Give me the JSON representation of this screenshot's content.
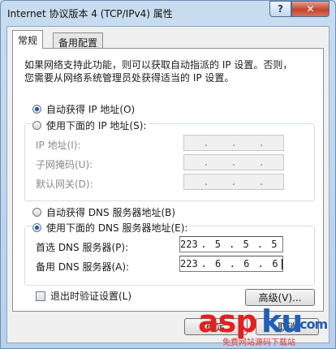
{
  "window": {
    "title": "Internet 协议版本 4 (TCP/IPv4) 属性",
    "help_label": "?",
    "close_label": "✕"
  },
  "tabs": [
    {
      "label": "常规",
      "active": true
    },
    {
      "label": "备用配置",
      "active": false
    }
  ],
  "description": [
    "如果网络支持此功能，则可以获取自动指派的 IP 设置。否则，",
    "您需要从网络系统管理员处获得适当的 IP 设置。"
  ],
  "ip_section": {
    "auto_label": "自动获得 IP 地址(O)",
    "manual_label": "使用下面的 IP 地址(S):",
    "selected": "auto",
    "fields": [
      {
        "label": "IP 地址(I):",
        "octets": [
          "",
          "",
          "",
          ""
        ]
      },
      {
        "label": "子网掩码(U):",
        "octets": [
          "",
          "",
          "",
          ""
        ]
      },
      {
        "label": "默认网关(D):",
        "octets": [
          "",
          "",
          "",
          ""
        ]
      }
    ]
  },
  "dns_section": {
    "auto_label": "自动获得 DNS 服务器地址(B)",
    "manual_label": "使用下面的 DNS 服务器地址(E):",
    "selected": "manual",
    "fields": [
      {
        "label": "首选 DNS 服务器(P):",
        "octets": [
          "223",
          "5",
          "5",
          "5"
        ]
      },
      {
        "label": "备用 DNS 服务器(A):",
        "octets": [
          "223",
          "6",
          "6",
          "6"
        ]
      }
    ]
  },
  "validate_label": "退出时验证设置(L)",
  "advanced_label": "高级(V)...",
  "ok_label": "确定",
  "cancel_label": "取消",
  "watermark": {
    "brand_a": "asp",
    "brand_b": "ku",
    "brand_c": ".com",
    "sub": "免费网站源码下载站"
  },
  "colors": {
    "radio_dot": "#1c58a8",
    "title_gradient_top": "#c9dcef",
    "close_red": "#c5452e",
    "wm_red": "#e32020",
    "wm_blue": "#1f5fb8"
  }
}
